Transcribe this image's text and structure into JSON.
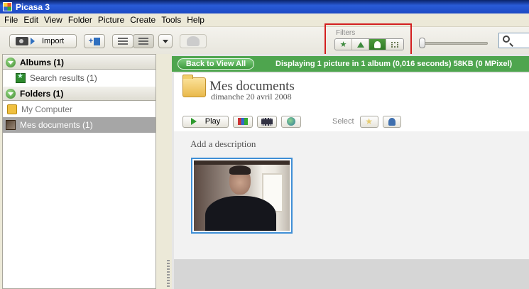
{
  "window": {
    "title": "Picasa 3"
  },
  "menu": [
    "File",
    "Edit",
    "View",
    "Folder",
    "Picture",
    "Create",
    "Tools",
    "Help"
  ],
  "toolbar": {
    "import_label": "Import",
    "filters_label": "Filters"
  },
  "sidebar": {
    "albums_label": "Albums (1)",
    "search_results_label": "Search results (1)",
    "folders_label": "Folders (1)",
    "my_computer_label": "My Computer",
    "mes_documents_label": "Mes documents (1)"
  },
  "main": {
    "back_label": "Back to View All",
    "status": "Displaying 1 picture in 1 album (0,016 seconds) 58KB (0 MPixel)",
    "folder_title": "Mes documents",
    "folder_date": "dimanche 20 avril 2008",
    "play_label": "Play",
    "select_label": "Select",
    "add_description": "Add a description"
  },
  "colors": {
    "filter_highlight": "#d31f1f",
    "status_bar_green": "#4ea54e",
    "selection_blue": "#3f8fd6"
  }
}
